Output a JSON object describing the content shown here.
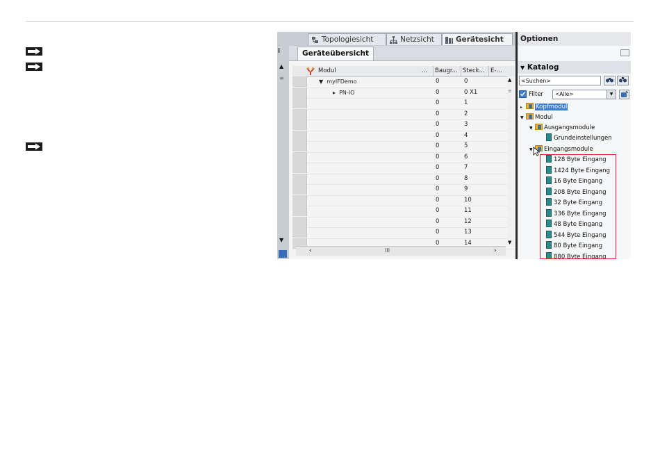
{
  "tabs": [
    {
      "label": "Topologiesicht",
      "icon": "topology-icon"
    },
    {
      "label": "Netzsicht",
      "icon": "network-icon"
    },
    {
      "label": "Gerätesicht",
      "icon": "device-icon"
    }
  ],
  "subtab": "Geräteübersicht",
  "table": {
    "headers": [
      "Modul",
      "...",
      "Baugr...",
      "Steck...",
      "E-..."
    ],
    "rows": [
      {
        "modul": "myIFDemo",
        "baugr": "0",
        "steck": "0"
      },
      {
        "modul": "PN-IO",
        "baugr": "0",
        "steck": "0 X1"
      },
      {
        "modul": "",
        "baugr": "0",
        "steck": "1"
      },
      {
        "modul": "",
        "baugr": "0",
        "steck": "2"
      },
      {
        "modul": "",
        "baugr": "0",
        "steck": "3"
      },
      {
        "modul": "",
        "baugr": "0",
        "steck": "4"
      },
      {
        "modul": "",
        "baugr": "0",
        "steck": "5"
      },
      {
        "modul": "",
        "baugr": "0",
        "steck": "6"
      },
      {
        "modul": "",
        "baugr": "0",
        "steck": "7"
      },
      {
        "modul": "",
        "baugr": "0",
        "steck": "8"
      },
      {
        "modul": "",
        "baugr": "0",
        "steck": "9"
      },
      {
        "modul": "",
        "baugr": "0",
        "steck": "10"
      },
      {
        "modul": "",
        "baugr": "0",
        "steck": "11"
      },
      {
        "modul": "",
        "baugr": "0",
        "steck": "12"
      },
      {
        "modul": "",
        "baugr": "0",
        "steck": "13"
      },
      {
        "modul": "",
        "baugr": "0",
        "steck": "14"
      }
    ],
    "hscroll_mark": "III"
  },
  "options": {
    "title": "Optionen",
    "katalog": "Katalog",
    "search_placeholder": "<Suchen>",
    "filter_label": "Filter",
    "filter_value": "<Alle>",
    "tree": [
      {
        "label": "Kopfmodul",
        "type": "folder",
        "level": 0,
        "expanded": false,
        "selected": true
      },
      {
        "label": "Modul",
        "type": "folder",
        "level": 0,
        "expanded": true
      },
      {
        "label": "Ausgangsmodule",
        "type": "folder",
        "level": 1,
        "expanded": true
      },
      {
        "label": "Grundeinstellungen",
        "type": "module",
        "level": 2
      },
      {
        "label": "Eingangsmodule",
        "type": "folder",
        "level": 1,
        "expanded": true
      },
      {
        "label": "128 Byte Eingang",
        "type": "module",
        "level": 2
      },
      {
        "label": "1424 Byte Eingang",
        "type": "module",
        "level": 2
      },
      {
        "label": "16 Byte Eingang",
        "type": "module",
        "level": 2
      },
      {
        "label": "208 Byte Eingang",
        "type": "module",
        "level": 2
      },
      {
        "label": "32 Byte Eingang",
        "type": "module",
        "level": 2
      },
      {
        "label": "336 Byte Eingang",
        "type": "module",
        "level": 2
      },
      {
        "label": "48 Byte Eingang",
        "type": "module",
        "level": 2
      },
      {
        "label": "544 Byte Eingang",
        "type": "module",
        "level": 2
      },
      {
        "label": "80 Byte Eingang",
        "type": "module",
        "level": 2
      },
      {
        "label": "880 Byte Eingang",
        "type": "module",
        "level": 2
      }
    ]
  },
  "colors": {
    "highlight_box": "#e0262c",
    "selection": "#3b7bd0"
  }
}
